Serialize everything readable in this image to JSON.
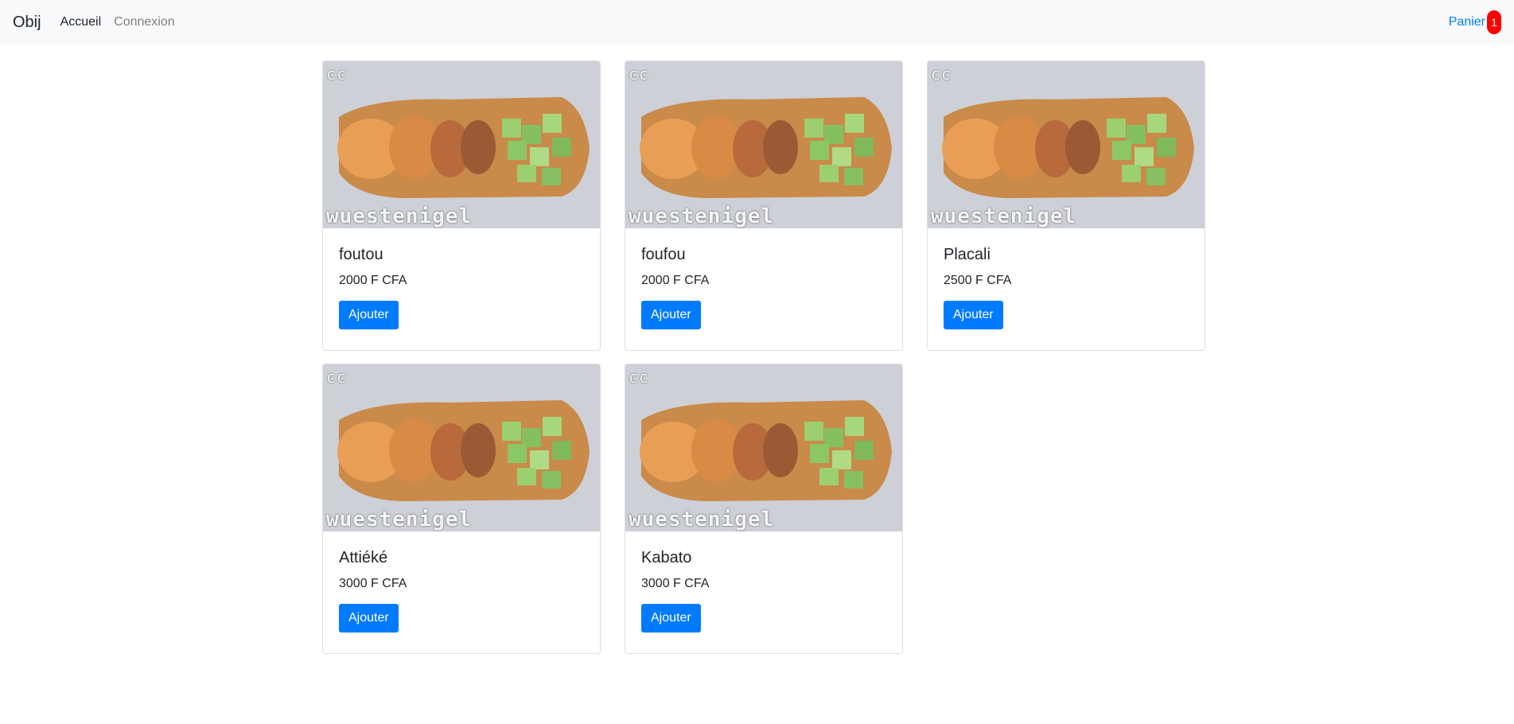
{
  "navbar": {
    "brand": "Obij",
    "links": [
      {
        "label": "Accueil"
      },
      {
        "label": "Connexion"
      }
    ],
    "cart": {
      "label": "Panier",
      "count": "1"
    }
  },
  "products": [
    {
      "name": "foutou",
      "price": "2000 F CFA",
      "button": "Ajouter",
      "image_badge": "cc",
      "image_watermark": "wuestenigel"
    },
    {
      "name": "foufou",
      "price": "2000 F CFA",
      "button": "Ajouter",
      "image_badge": "cc",
      "image_watermark": "wuestenigel"
    },
    {
      "name": "Placali",
      "price": "2500 F CFA",
      "button": "Ajouter",
      "image_badge": "cc",
      "image_watermark": "wuestenigel"
    },
    {
      "name": "Attiéké",
      "price": "3000 F CFA",
      "button": "Ajouter",
      "image_badge": "cc",
      "image_watermark": "wuestenigel"
    },
    {
      "name": "Kabato",
      "price": "3000 F CFA",
      "button": "Ajouter",
      "image_badge": "cc",
      "image_watermark": "wuestenigel"
    }
  ],
  "colors": {
    "primary": "#007bff",
    "badge": "#ff0000",
    "navbar_bg": "#f8f9fa"
  }
}
